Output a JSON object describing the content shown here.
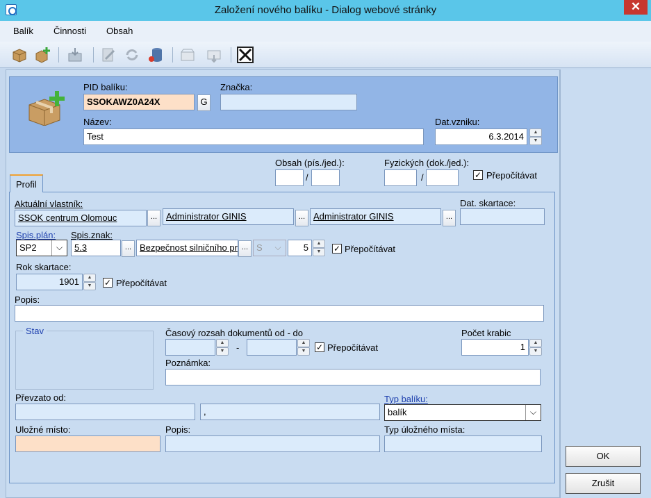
{
  "window": {
    "title": "Založení nového balíku - Dialog webové stránky",
    "close_glyph": "✕"
  },
  "menu": [
    "Balík",
    "Činnosti",
    "Obsah"
  ],
  "toolbar_icons": [
    "package-icon",
    "package-add-icon",
    "import-icon",
    "edit-icon",
    "refresh-icon",
    "database-icon",
    "tray-icon",
    "tray-down-icon",
    "close-x-icon"
  ],
  "header": {
    "pid_label": "PID balíku:",
    "pid_value": "SSOKAWZ0A24X",
    "g_button": "G",
    "znacka_label": "Značka:",
    "znacka_value": "",
    "nazev_label": "Název:",
    "nazev_value": "Test",
    "dat_vzniku_label": "Dat.vzniku:",
    "dat_vzniku_value": "6.3.2014"
  },
  "counts": {
    "obsah_label": "Obsah (pís./jed.):",
    "fyzickych_label": "Fyzických (dok./jed.):",
    "slash": "/",
    "prepocitavat": "Přepočítávat"
  },
  "tab": {
    "label": "Profil"
  },
  "profil": {
    "owner_label": "Aktuální vlastník:",
    "owner_org": "SSOK  centrum Olomouc",
    "owner_user1": "Administrator GINIS",
    "owner_user2": "Administrator GINIS",
    "dat_skartace_label": "Dat. skartace:",
    "dat_skartace_value": "",
    "spis_plan_label": "Spis.plán:",
    "spis_plan_value": "SP2",
    "spis_znak_label": "Spis.znak:",
    "spis_znak_value": "5.3",
    "spis_znak_desc": "Bezpečnost silničního pr",
    "skart_znak": "S",
    "skart_lhuta": "5",
    "prepocitavat": "Přepočítávat",
    "rok_skartace_label": "Rok skartace:",
    "rok_skartace_value": "1901",
    "popis_label": "Popis:",
    "popis_value": "",
    "stav_label": "Stav",
    "casovy_rozsah_label": "Časový rozsah dokumentů od - do",
    "range_dash": "-",
    "pocet_krabic_label": "Počet krabic",
    "pocet_krabic_value": "1",
    "poznamka_label": "Poznámka:",
    "poznamka_value": "",
    "prevzato_label": "Převzato od:",
    "prevzato_value": "",
    "prevzato_value2": ",",
    "typ_baliku_label": "Typ balíku:",
    "typ_baliku_value": "balík",
    "ulozne_misto_label": "Uložné místo:",
    "popis2_label": "Popis:",
    "typ_ulozneho_label": "Typ úložného místa:"
  },
  "buttons": {
    "ok": "OK",
    "cancel": "Zrušit"
  },
  "check": "✓",
  "ellipsis": "...",
  "arrow_down": "⌵"
}
